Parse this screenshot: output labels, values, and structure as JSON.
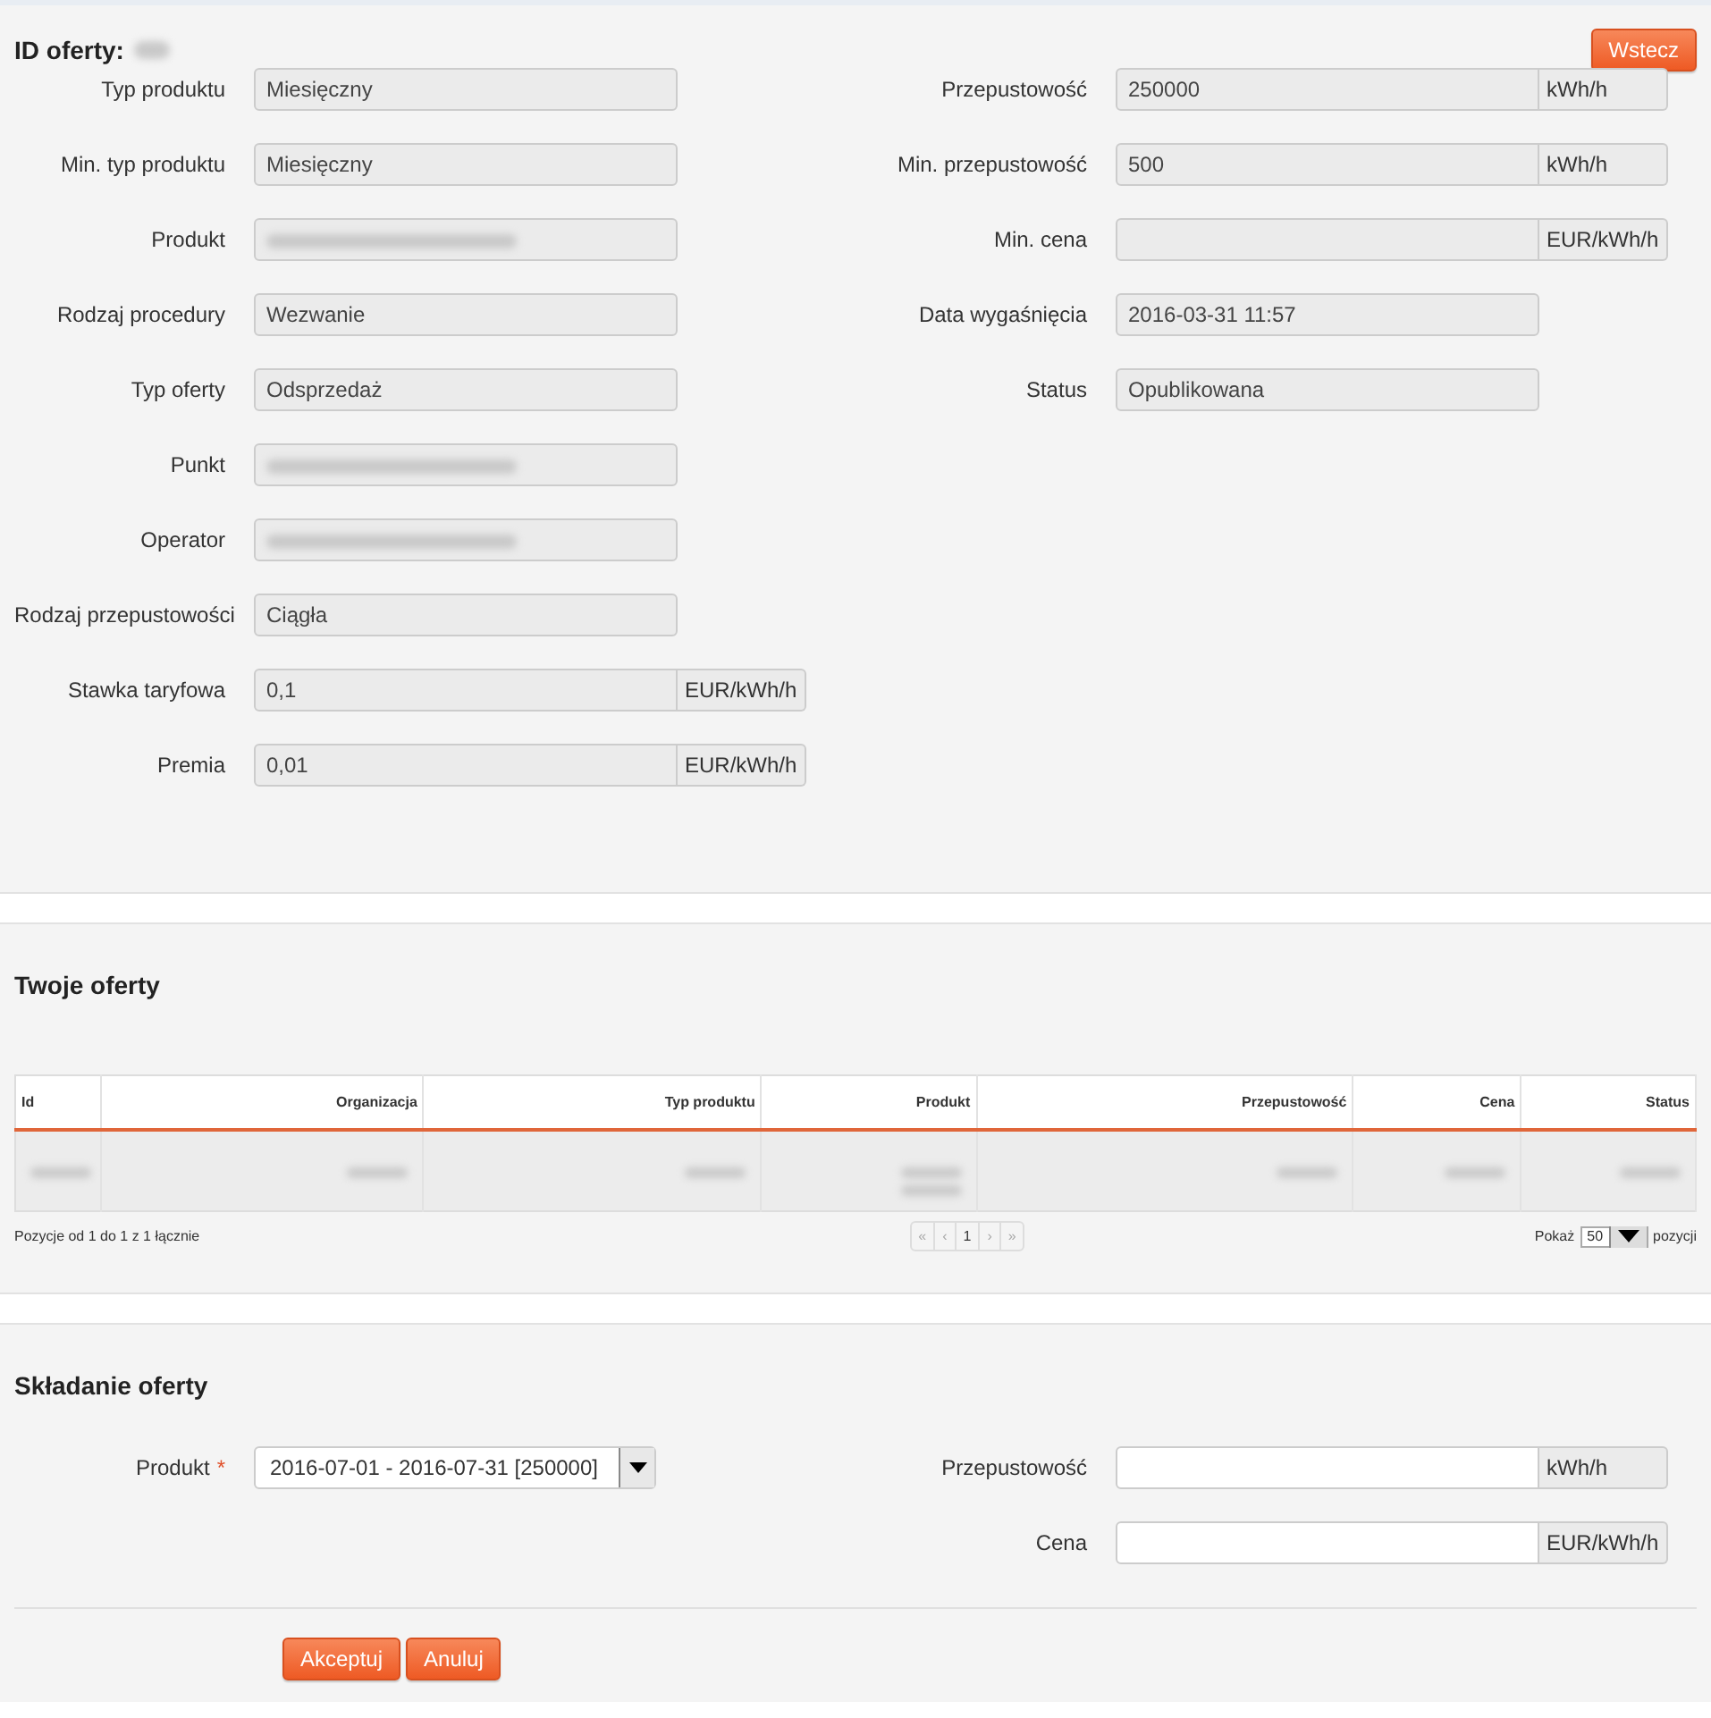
{
  "offer_details": {
    "title": "ID oferty:",
    "title_id_redacted": true,
    "back_button": "Wstecz",
    "left_fields": [
      {
        "label": "Typ produktu",
        "value": "Miesięczny",
        "redacted": false
      },
      {
        "label": "Min. typ produktu",
        "value": "Miesięczny",
        "redacted": false
      },
      {
        "label": "Produkt",
        "redacted": true
      },
      {
        "label": "Rodzaj procedury",
        "value": "Wezwanie",
        "redacted": false
      },
      {
        "label": "Typ oferty",
        "value": "Odsprzedaż",
        "redacted": false
      },
      {
        "label": "Punkt",
        "redacted": true
      },
      {
        "label": "Operator",
        "redacted": true
      },
      {
        "label": "Rodzaj przepustowości",
        "value": "Ciągła",
        "redacted": false
      },
      {
        "label": "Stawka taryfowa",
        "value": "0,1",
        "unit": "EUR/kWh/h",
        "redacted": false
      },
      {
        "label": "Premia",
        "value": "0,01",
        "unit": "EUR/kWh/h",
        "redacted": false
      }
    ],
    "right_fields": [
      {
        "label": "Przepustowość",
        "value": "250000",
        "unit": "kWh/h",
        "redacted": false
      },
      {
        "label": "Min. przepustowość",
        "value": "500",
        "unit": "kWh/h",
        "redacted": false
      },
      {
        "label": "Min. cena",
        "unit": "EUR/kWh/h",
        "redacted": false
      },
      {
        "label": "Data wygaśnięcia",
        "value": "2016-03-31 11:57",
        "redacted": false
      },
      {
        "label": "Status",
        "value": "Opublikowana",
        "redacted": false
      }
    ]
  },
  "your_offers": {
    "title": "Twoje oferty",
    "table": {
      "columns": [
        "Id",
        "Organizacja",
        "Typ produktu",
        "Produkt",
        "Przepustowość",
        "Cena",
        "Status"
      ],
      "rows": [
        {
          "redacted": true
        }
      ]
    },
    "summary": "Pozycje od 1 do 1 z 1 łącznie",
    "pagination": [
      {
        "label": "«",
        "disabled": true
      },
      {
        "label": "‹",
        "disabled": true
      },
      {
        "label": "1",
        "disabled": false
      },
      {
        "label": "›",
        "disabled": true
      },
      {
        "label": "»",
        "disabled": true
      }
    ],
    "page_size": {
      "before": "Pokaż",
      "value": "50",
      "after": "pozycji"
    }
  },
  "submit_offer": {
    "title": "Składanie oferty",
    "product": {
      "label": "Produkt",
      "required_mark": "*",
      "value": "2016-07-01 - 2016-07-31 [250000]"
    },
    "fields": [
      {
        "label": "Przepustowość",
        "unit": "kWh/h"
      },
      {
        "label": "Cena",
        "unit": "EUR/kWh/h"
      }
    ],
    "buttons": [
      "Akceptuj",
      "Anuluj"
    ]
  }
}
